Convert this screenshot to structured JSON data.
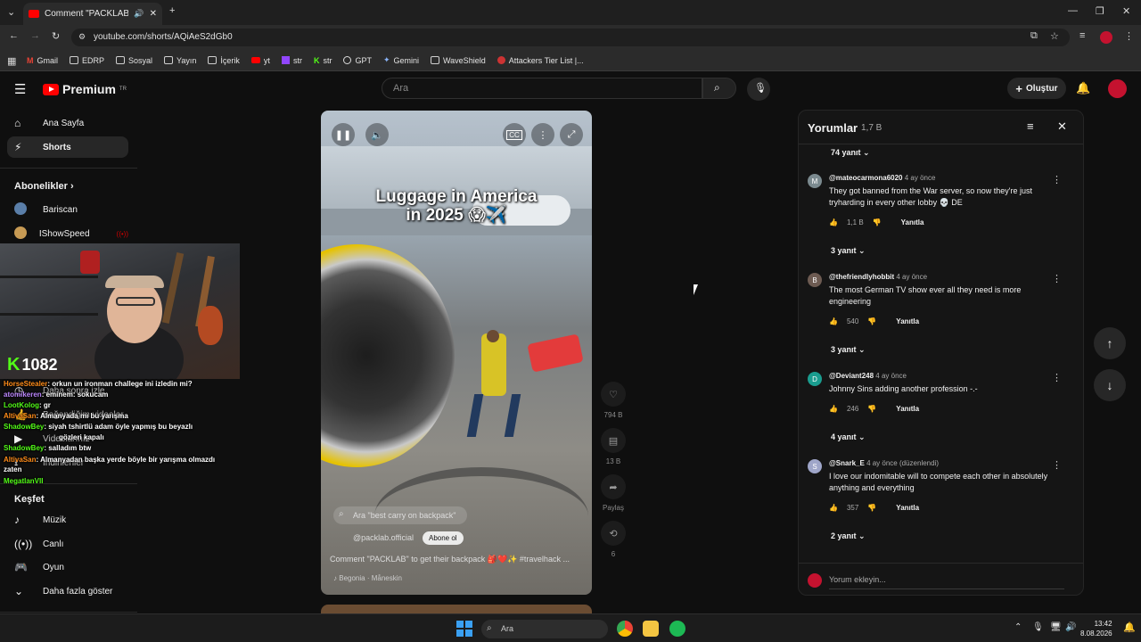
{
  "browser": {
    "tab_title": "Comment \"PACKLAB\" to ge",
    "url": "youtube.com/shorts/AQiAeS2dGb0",
    "bookmarks": [
      "Gmail",
      "EDRP",
      "Sosyal",
      "Yayın",
      "İçerik",
      "yt",
      "str",
      "str",
      "GPT",
      "Gemini",
      "WaveShield",
      "Attackers Tier List |..."
    ]
  },
  "header": {
    "logo_text": "Premium",
    "logo_sup": "TR",
    "search_placeholder": "Ara",
    "create_label": "Oluştur"
  },
  "sidebar": {
    "home": "Ana Sayfa",
    "shorts": "Shorts",
    "subs_title": "Abonelikler",
    "subs": [
      "Bariscan",
      "IShowSpeed"
    ],
    "hidden_items": [
      "Daha sonra izle",
      "Beğendiğim videolar",
      "Videolarınız",
      "İndirilenler"
    ],
    "explore_title": "Keşfet",
    "explore": [
      "Müzik",
      "Canlı",
      "Oyun",
      "Daha fazla göster"
    ]
  },
  "stream": {
    "viewer_count": "1082",
    "chat": [
      {
        "user": "HorseStealer",
        "msg": "orkun un ironman challege ini izledin mi?"
      },
      {
        "user": "atomikeren",
        "msg": "eminem: sokucam"
      },
      {
        "user": "LootKolog",
        "msg": "gr"
      },
      {
        "user": "AltivaSan",
        "msg": "Almanyada mı bu yarışma"
      },
      {
        "user": "ShadowBey",
        "msg": "siyah tshirtlü adam öyle yapmış bu beyazlı"
      },
      {
        "user": "",
        "msg": "gözleri kapalı"
      },
      {
        "user": "ShadowBey",
        "msg": "salladım btw"
      },
      {
        "user": "AltivaSan",
        "msg": "Almanyadan başka yerde böyle bir yarışma olmazdı zaten"
      },
      {
        "user": "MegatlanVII",
        "msg": ""
      }
    ]
  },
  "video": {
    "caption_line1": "Luggage in America",
    "caption_line2": "in 2025 😱✈️",
    "search_suggestion": "Ara \"best carry on backpack\"",
    "channel": "@packlab.official",
    "subscribe": "Abone ol",
    "title": "Comment \"PACKLAB\" to get their backpack 🎒❤️✨ #travelhack ...",
    "sound": "Begonia · Måneskin",
    "likes": "794 B",
    "comments": "13 B",
    "share": "Paylaş",
    "remix": "6"
  },
  "comments_panel": {
    "title": "Yorumlar",
    "count": "1,7 B",
    "reply_button": "Yanıtla",
    "add_placeholder": "Yorum ekleyin...",
    "first_replies": "74 yanıt",
    "items": [
      {
        "user": "@mateocarmona6020",
        "time": "4 ay önce",
        "text": "They got banned from the War server, so now they're just tryharding in every other lobby 💀 DE",
        "likes": "1,1 B",
        "replies": "3 yanıt",
        "avatar": "M",
        "avatar_color": "#7b8a8f"
      },
      {
        "user": "@thefriendlyhobbit",
        "time": "4 ay önce",
        "text": "The most German TV show ever all they need is more engineering",
        "likes": "540",
        "replies": "3 yanıt",
        "avatar": "B",
        "avatar_color": "#6d5b52"
      },
      {
        "user": "@Deviant248",
        "time": "4 ay önce",
        "text": "Johnny Sins adding another profession -.-",
        "likes": "246",
        "replies": "4 yanıt",
        "avatar": "D",
        "avatar_color": "#1a9d8f"
      },
      {
        "user": "@Snark_E",
        "time": "4 ay önce (düzenlendi)",
        "text": "I love our indomitable will to compete each other in absolutely anything and everything",
        "likes": "357",
        "replies": "2 yanıt",
        "avatar": "S",
        "avatar_color": "#9fa6c9"
      }
    ]
  },
  "taskbar": {
    "search_placeholder": "Ara",
    "time": "13:42",
    "date": "8.08.2026"
  },
  "colors": {
    "youtube_red": "#ff0000",
    "kick_green": "#53fc18",
    "background": "#0f0f0f"
  }
}
